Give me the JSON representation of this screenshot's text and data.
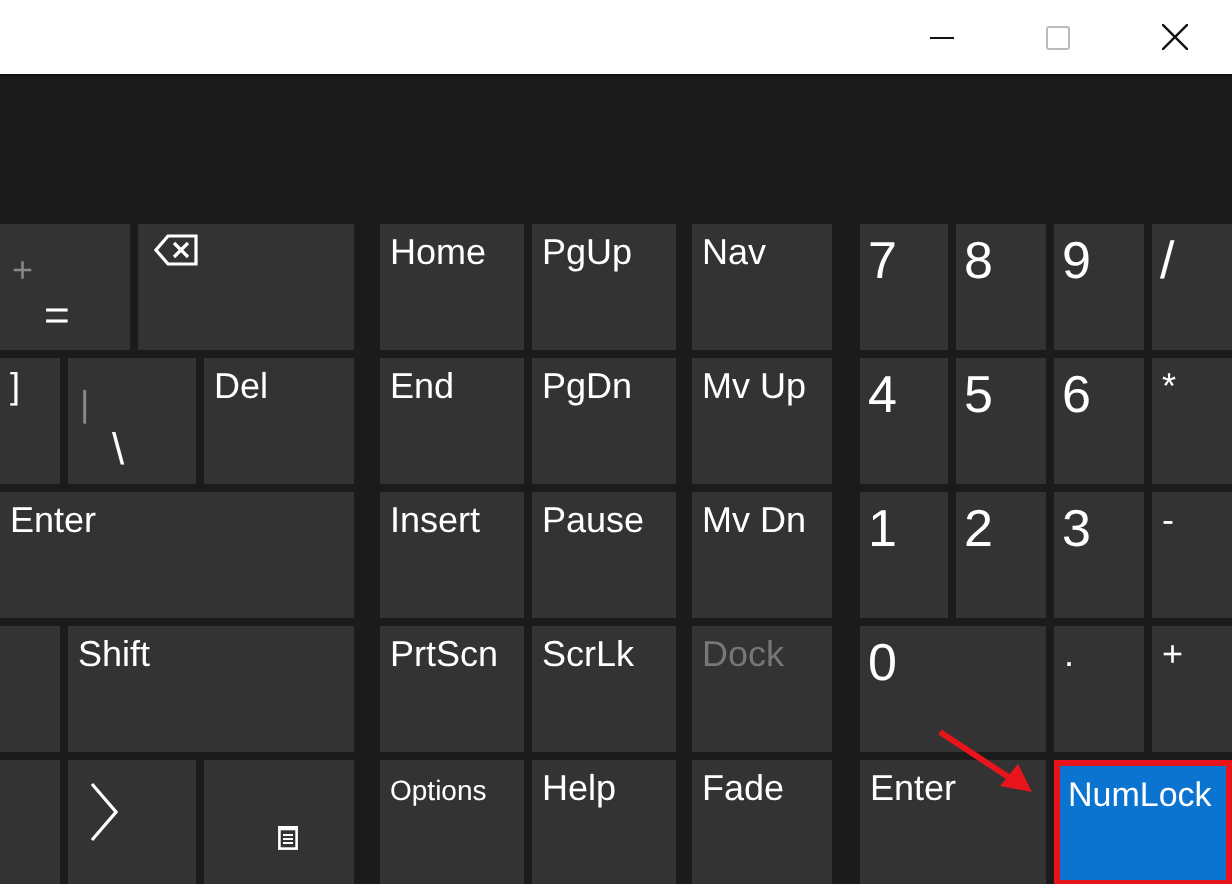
{
  "window_controls": [
    {
      "kind": "minimize",
      "disabled": false
    },
    {
      "kind": "maximize",
      "disabled": true
    },
    {
      "kind": "close",
      "disabled": false
    }
  ],
  "keyboard": {
    "rows": [
      {
        "keys": [
          {
            "kind": "dual",
            "shift": "+",
            "label": "="
          },
          {
            "kind": "backspace"
          },
          {
            "kind": "label",
            "label": "Home"
          },
          {
            "kind": "label",
            "label": "PgUp"
          },
          {
            "kind": "label",
            "label": "Nav"
          },
          {
            "kind": "digit",
            "label": "7"
          },
          {
            "kind": "digit",
            "label": "8"
          },
          {
            "kind": "digit",
            "label": "9"
          },
          {
            "kind": "digit",
            "label": "/"
          }
        ]
      },
      {
        "keys": [
          {
            "kind": "label",
            "label": "]"
          },
          {
            "kind": "dual",
            "shift": "|",
            "label": "\\"
          },
          {
            "kind": "label",
            "label": "Del"
          },
          {
            "kind": "label",
            "label": "End"
          },
          {
            "kind": "label",
            "label": "PgDn"
          },
          {
            "kind": "label",
            "label": "Mv Up"
          },
          {
            "kind": "digit",
            "label": "4"
          },
          {
            "kind": "digit",
            "label": "5"
          },
          {
            "kind": "digit",
            "label": "6"
          },
          {
            "kind": "label",
            "label": "*"
          }
        ]
      },
      {
        "keys": [
          {
            "kind": "label",
            "label": "Enter"
          },
          {
            "kind": "label",
            "label": "Insert"
          },
          {
            "kind": "label",
            "label": "Pause"
          },
          {
            "kind": "label",
            "label": "Mv Dn"
          },
          {
            "kind": "digit",
            "label": "1"
          },
          {
            "kind": "digit",
            "label": "2"
          },
          {
            "kind": "digit",
            "label": "3"
          },
          {
            "kind": "label",
            "label": "-"
          }
        ]
      },
      {
        "keys": [
          {
            "kind": "blank"
          },
          {
            "kind": "label",
            "label": "Shift"
          },
          {
            "kind": "label",
            "label": "PrtScn"
          },
          {
            "kind": "label",
            "label": "ScrLk"
          },
          {
            "kind": "label",
            "label": "Dock",
            "disabled": true
          },
          {
            "kind": "digit",
            "label": "0"
          },
          {
            "kind": "label",
            "label": "."
          },
          {
            "kind": "label",
            "label": "+"
          }
        ]
      },
      {
        "keys": [
          {
            "kind": "blank"
          },
          {
            "kind": "chevron"
          },
          {
            "kind": "menu"
          },
          {
            "kind": "small",
            "label": "Options"
          },
          {
            "kind": "label",
            "label": "Help"
          },
          {
            "kind": "label",
            "label": "Fade"
          },
          {
            "kind": "label",
            "label": "Enter"
          },
          {
            "kind": "label",
            "label": "NumLock",
            "selected": true,
            "highlighted": true
          }
        ]
      }
    ]
  }
}
